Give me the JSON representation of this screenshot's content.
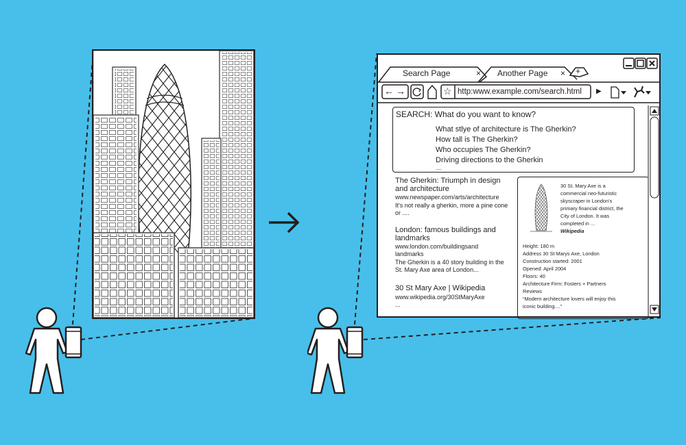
{
  "colors": {
    "background": "#47BFEA",
    "line": "#231f20",
    "fill": "#ffffff",
    "window_grid": "#c8c8c8"
  },
  "illustration": {
    "left_scene": "user holding phone camera pointed at city skyline with The Gherkin",
    "arrow_icon": "right-arrow",
    "right_scene": "user holding phone viewing browser search results about The Gherkin"
  },
  "browser": {
    "tabs": [
      {
        "label": "Search Page",
        "close_icon": "×"
      },
      {
        "label": "Another Page",
        "close_icon": "×"
      }
    ],
    "new_tab_icon": "+",
    "window_controls": [
      "minimize",
      "maximize",
      "close"
    ],
    "toolbar": {
      "back_icon": "←",
      "forward_icon": "→",
      "reload_icon": "reload",
      "home_icon": "home",
      "bookmark_icon": "☆",
      "url": "http:www.example.com/search.html",
      "play_icon": "▶",
      "page_menu_icon": "page",
      "tools_menu_icon": "wrench"
    },
    "search": {
      "title": "SEARCH: What do you want to know?",
      "suggestions": [
        "What stlye of architecture is The Gherkin?",
        "How tall is The Gherkin?",
        "Who occupies The Gherkin?",
        "Driving directions to the Gherkin",
        "...."
      ]
    },
    "results": [
      {
        "title_lines": [
          "The Gherkin: Triumph in design",
          "and architecture"
        ],
        "url_lines": [
          "www.newspaper.com/arts/architecture"
        ],
        "desc_lines": [
          "It's not really a gherkin, more a pine cone",
          "or ...."
        ]
      },
      {
        "title_lines": [
          "London: famous buildings and",
          "landmarks"
        ],
        "url_lines": [
          "www.london.com/buildingsand",
          "landmarks"
        ],
        "desc_lines": [
          "The Gherkin is a 40 story building in the",
          "St. Mary Axe area of London..."
        ]
      },
      {
        "title_lines": [
          "30 St Mary Axe | Wikipedia"
        ],
        "url_lines": [
          "www.wikipedia.org/30StMaryAxe"
        ],
        "desc_lines": [
          "..."
        ]
      }
    ],
    "knowledge_panel": {
      "summary_lines": [
        "30 St. Mary Axe is a",
        "commercial neo-futuristic",
        "skyscraper in London's",
        "primary financial district, the",
        "City of London. It was",
        "completed in ..."
      ],
      "source": "Wikipedia",
      "facts": [
        "Height: 180 m",
        "Address 30 St Marys Axe, London",
        "Construction started: 2001",
        "Opened: April 2004",
        "Floors: 40",
        "Architecture Firm: Fosters + Partners",
        "Reviews",
        "“Modern architecture lovers will enjoy this",
        "iconic building....”"
      ]
    }
  }
}
